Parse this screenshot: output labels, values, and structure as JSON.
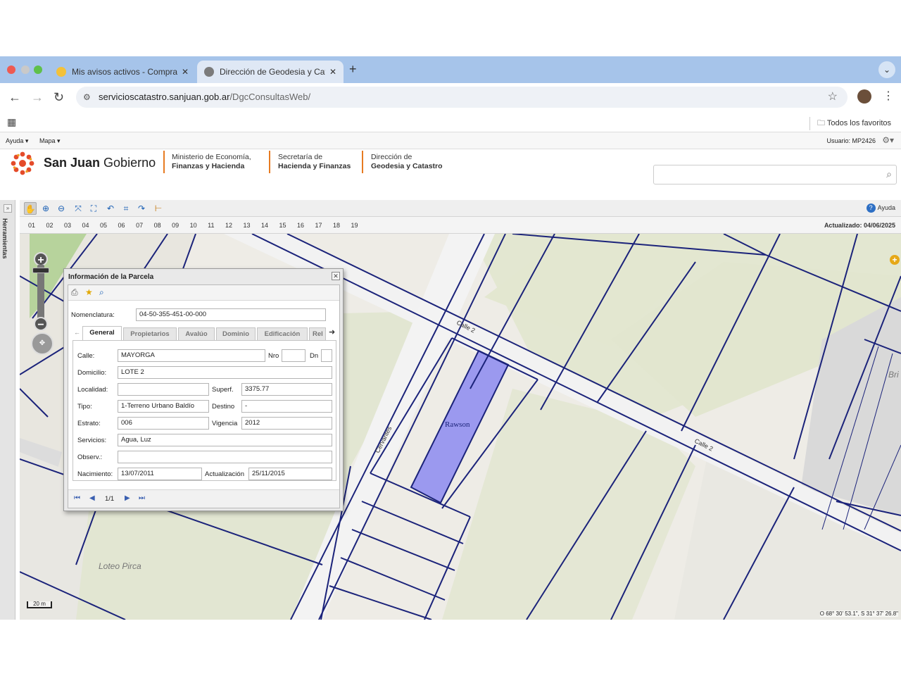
{
  "browser": {
    "tabs": [
      {
        "title": "Mis avisos activos - Compra",
        "active": false
      },
      {
        "title": "Dirección de Geodesia y Cata",
        "active": true
      }
    ],
    "new_tab_label": "+",
    "url_host": "servicioscatastro.sanjuan.gob.ar",
    "url_path": "/DgcConsultasWeb/",
    "bookmarks_folder": "Todos los favoritos"
  },
  "app_menu": {
    "items": [
      "Ayuda ▾",
      "Mapa ▾"
    ],
    "user_label": "Usuario: MP2426"
  },
  "header": {
    "brand_bold": "San Juan",
    "brand_regular": "Gobierno",
    "orgs": [
      {
        "line1": "Ministerio de Economía,",
        "line2": "Finanzas y Hacienda"
      },
      {
        "line1": "Secretaría de",
        "line2": "Hacienda y Finanzas"
      },
      {
        "line1": "Dirección de",
        "line2": "Geodesia y Catastro"
      }
    ],
    "search_placeholder": ""
  },
  "sidepanel": {
    "label": "Herramientas"
  },
  "map_toolbar": {
    "tools": [
      "pan-icon",
      "zoom-in-icon",
      "zoom-out-icon",
      "zoom-extent-icon",
      "full-extent-icon",
      "undo-icon",
      "select-icon",
      "redo-icon",
      "measure-icon"
    ],
    "help_label": "Ayuda"
  },
  "number_bar": {
    "numbers": "01 02 03 04 05 06 07 08 09 10 11 12 13 14 15 16 17 18 19",
    "updated": "Actualizado: 04/06/2025"
  },
  "map": {
    "labels": {
      "calle2_a": "Calle 2",
      "calle2_b": "Calle 2",
      "cervantes": "Cervantes",
      "rawson": "Rawson",
      "loteo": "Loteo Pirca",
      "bri": "Bri"
    },
    "scale": "20 m",
    "coords": "O 68° 30' 53.1\", S 31° 37' 26.8\"",
    "colors": {
      "lines": "#1b237a",
      "parcel_fill": "#9b99ef",
      "green": "#b7d39c"
    }
  },
  "dialog": {
    "title": "Información de la Parcela",
    "nomenclatura_label": "Nomenclatura:",
    "nomenclatura_value": "04-50-355-451-00-000",
    "tabs": [
      "General",
      "Propietarios",
      "Avalúo",
      "Dominio",
      "Edificación",
      "Rel"
    ],
    "active_tab": "General",
    "fields": {
      "calle_label": "Calle:",
      "calle": "MAYORGA",
      "nro_label": "Nro",
      "nro": "",
      "dn_label": "Dn",
      "dn": "",
      "domicilio_label": "Domicilio:",
      "domicilio": "LOTE 2",
      "localidad_label": "Localidad:",
      "localidad": "",
      "superf_label": "Superf.",
      "superf": "3375.77",
      "tipo_label": "Tipo:",
      "tipo": "1-Terreno Urbano Baldío",
      "destino_label": "Destino",
      "destino": "-",
      "estrato_label": "Estrato:",
      "estrato": "006",
      "vigencia_label": "Vigencia",
      "vigencia": "2012",
      "servicios_label": "Servicios:",
      "servicios": "Agua, Luz",
      "observ_label": "Observ.:",
      "observ": "",
      "nacimiento_label": "Nacimiento:",
      "nacimiento": "13/07/2011",
      "actualizacion_label": "Actualización",
      "actualizacion": "25/11/2015"
    },
    "pager": "1/1"
  }
}
